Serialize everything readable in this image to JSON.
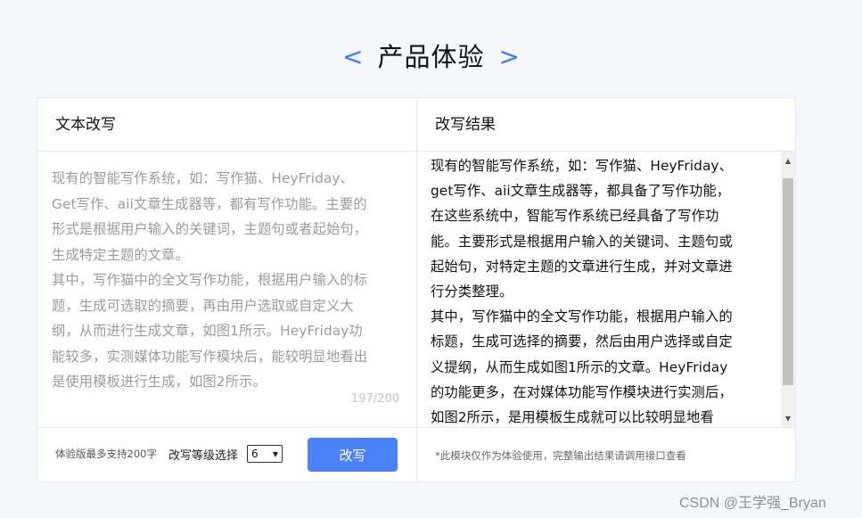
{
  "header": {
    "left_bracket": "<",
    "title": "产品体验",
    "right_bracket": ">"
  },
  "left_panel": {
    "label": "文本改写",
    "input_lines": [
      "现有的智能写作系统，如：写作猫、HeyFriday、",
      "Get写作、aii文章生成器等，都有写作功能。主要的",
      "形式是根据用户输入的关键词，主题句或者起始句，",
      "生成特定主题的文章。",
      "其中，写作猫中的全文写作功能，根据用户输入的标",
      "题，生成可选取的摘要，再由用户选取或自定义大",
      "纲，从而进行生成文章，如图1所示。HeyFriday功",
      "能较多，实测媒体功能写作模块后，能较明显地看出",
      "是使用模板进行生成，如图2所示。"
    ],
    "counter": "197/200"
  },
  "right_panel": {
    "label": "改写结果",
    "result_lines": [
      "现有的智能写作系统，如：写作猫、HeyFriday、",
      "get写作、aii文章生成器等，都具备了写作功能，",
      "在这些系统中，智能写作系统已经具备了写作功",
      "能。主要形式是根据用户输入的关键词、主题句或",
      "起始句，对特定主题的文章进行生成，并对文章进",
      "行分类整理。",
      "其中，写作猫中的全文写作功能，根据用户输入的",
      "标题，生成可选择的摘要，然后由用户选择或自定",
      "义提纲，从而生成如图1所示的文章。HeyFriday",
      "的功能更多，在对媒体功能写作模块进行实测后，",
      "如图2所示，是用模板生成就可以比较明显地看"
    ]
  },
  "footer": {
    "limit_text": "体验版最多支持200字",
    "level_label": "改写等级选择",
    "level_value": "6",
    "rewrite_button": "改写",
    "notice": "*此模块仅作为体验使用，完整输出结果请调用接口查看"
  },
  "watermark": "CSDN @王学强_Bryan",
  "icons": {
    "scroll_up": "scroll-up-arrow-icon",
    "scroll_down": "scroll-down-arrow-icon",
    "select_chevron": "chevron-down-icon"
  },
  "colors": {
    "accent": "#4b82f5",
    "bracket": "#3d7cf0",
    "placeholder_text": "#9a9a9a",
    "page_background": "#f4f7fb"
  }
}
